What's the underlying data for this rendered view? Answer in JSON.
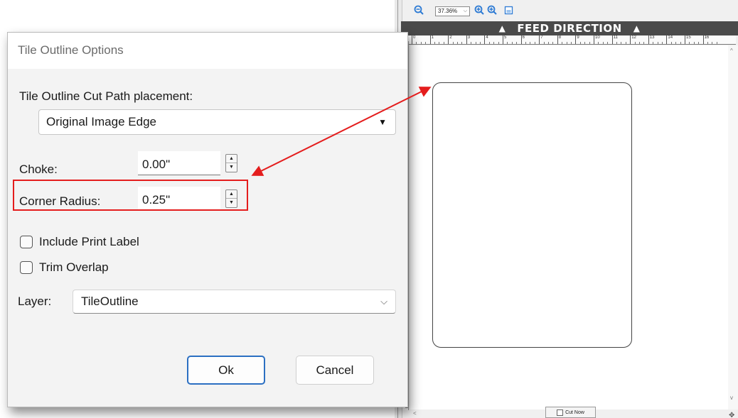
{
  "app": {
    "zoom": "37.36%",
    "feed_direction": "FEED DIRECTION",
    "ruler_marks": [
      "0",
      "1",
      "2",
      "3",
      "4",
      "5",
      "6",
      "7",
      "8",
      "9",
      "10",
      "11",
      "12",
      "13",
      "14",
      "15",
      "16"
    ],
    "cut_now_label": "Cut Now",
    "icons": {
      "zoom_out": "zoom-out-icon",
      "zoom_in": "zoom-in-icon",
      "fit": "page-fit-icon",
      "feed_arrow": "arrow-up-icon"
    }
  },
  "dialog": {
    "title": "Tile Outline Options",
    "placement_label": "Tile Outline Cut Path placement:",
    "placement_value": "Original Image Edge",
    "choke_label": "Choke:",
    "choke_value": "0.00\"",
    "corner_radius_label": "Corner Radius:",
    "corner_radius_value": "0.25\"",
    "include_print_label": "Include Print Label",
    "include_print_label_checked": false,
    "trim_overlap": "Trim Overlap",
    "trim_overlap_checked": false,
    "layer_label": "Layer:",
    "layer_value": "TileOutline",
    "ok_label": "Ok",
    "cancel_label": "Cancel"
  },
  "annotation": {
    "color": "#e41d1d"
  }
}
